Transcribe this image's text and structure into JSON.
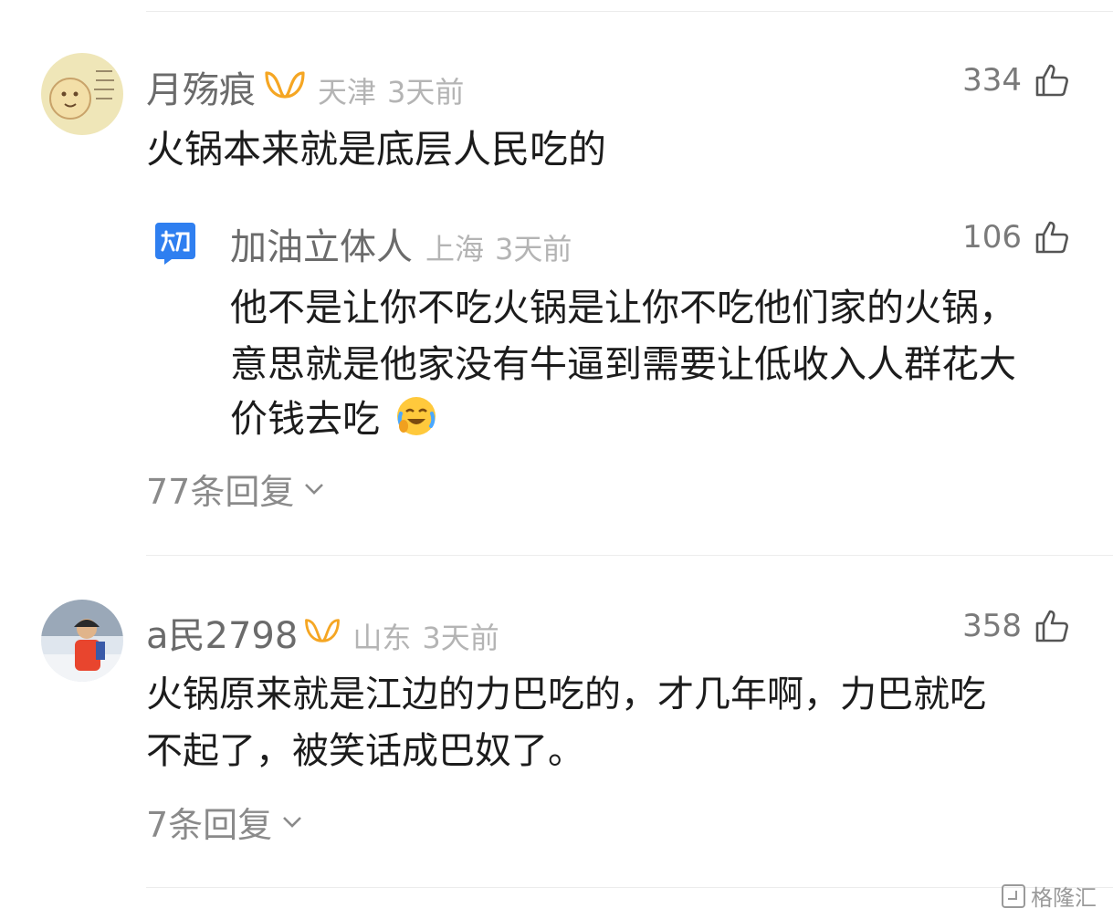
{
  "comments": [
    {
      "user": "月殇痕",
      "location": "天津",
      "time": "3天前",
      "likes": "334",
      "text": "火锅本来就是底层人民吃的",
      "replies_label": "77条回复",
      "sub_reply": {
        "user": "加油立体人",
        "location": "上海",
        "time": "3天前",
        "likes": "106",
        "lines": [
          "他不是让你不吃火锅是让你不吃他们家的火锅，",
          "意思就是他家没有牛逼到需要让低收入人群花大",
          "价钱去吃"
        ]
      }
    },
    {
      "user": "a民2798",
      "location": "山东",
      "time": "3天前",
      "likes": "358",
      "lines": [
        "火锅原来就是江边的力巴吃的，才几年啊，力巴就吃",
        "不起了，被笑话成巴奴了。"
      ],
      "replies_label": "7条回复"
    }
  ],
  "watermark": "格隆汇",
  "colors": {
    "vip_badge": "#f5a623",
    "username": "#6b6b6b",
    "meta": "#b4b4b4",
    "body": "#1c1c1c"
  }
}
